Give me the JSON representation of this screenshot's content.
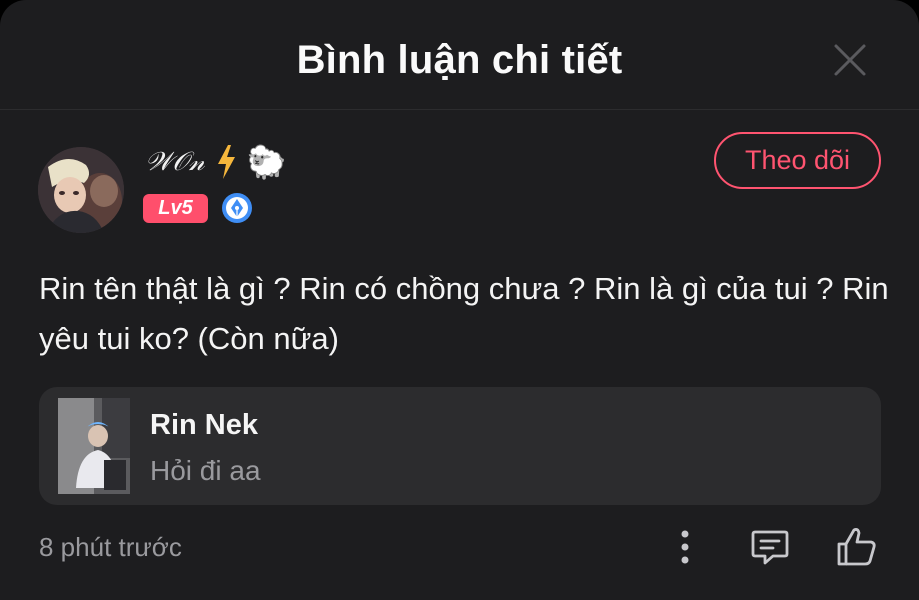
{
  "header": {
    "title": "Bình luận chi tiết",
    "close_icon": "close-icon"
  },
  "comment": {
    "author": {
      "username": "𝒲𝒪𝓃",
      "emoji_badges": [
        "lightning-icon",
        "🐑"
      ],
      "level": "Lv5",
      "badge_icon": "pen-nib-badge-icon"
    },
    "follow_label": "Theo dõi",
    "text": "Rin tên thật là gì ? Rin có chồng chưa ? Rin là gì của tui ? Rin yêu tui ko? (Còn nữa)",
    "timestamp": "8 phút trước"
  },
  "quoted_reply": {
    "name": "Rin Nek",
    "text": "Hỏi đi aa"
  },
  "actions": [
    "more-icon",
    "reply-icon",
    "like-icon"
  ],
  "colors": {
    "background": "#1d1d1f",
    "accent": "#ff5470",
    "card": "#2c2c2e",
    "muted_text": "#9a9a9e"
  }
}
